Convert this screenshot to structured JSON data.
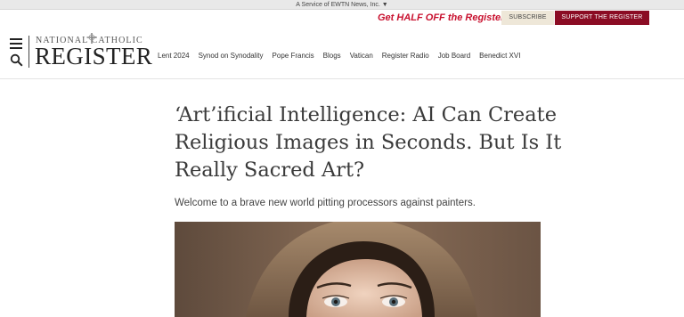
{
  "topbar": {
    "service_text": "A Service of EWTN News, Inc. ▼"
  },
  "header": {
    "promo_text": "Get HALF OFF the Register!",
    "subscribe_label": "SUBSCRIBE",
    "support_label": "SUPPORT THE REGISTER",
    "logo_top": "NATIONAL CATHOLIC",
    "logo_main": "REGISTER"
  },
  "icons": {
    "menu": "hamburger-menu-icon",
    "search": "search-icon",
    "logo_emblem": "cross-icon"
  },
  "nav": {
    "items": [
      "Lent 2024",
      "Synod on Synodality",
      "Pope Francis",
      "Blogs",
      "Vatican",
      "Register Radio",
      "Job Board",
      "Benedict XVI"
    ]
  },
  "article": {
    "headline": "‘Art’ificial Intelligence: AI Can Create Religious Images in Seconds. But Is It Really Sacred Art?",
    "dek": "Welcome to a brave new world pitting processors against painters."
  },
  "colors": {
    "brand_red": "#8b0c24",
    "promo_red": "#c8102e",
    "subscribe_bg": "#eee7d8"
  }
}
